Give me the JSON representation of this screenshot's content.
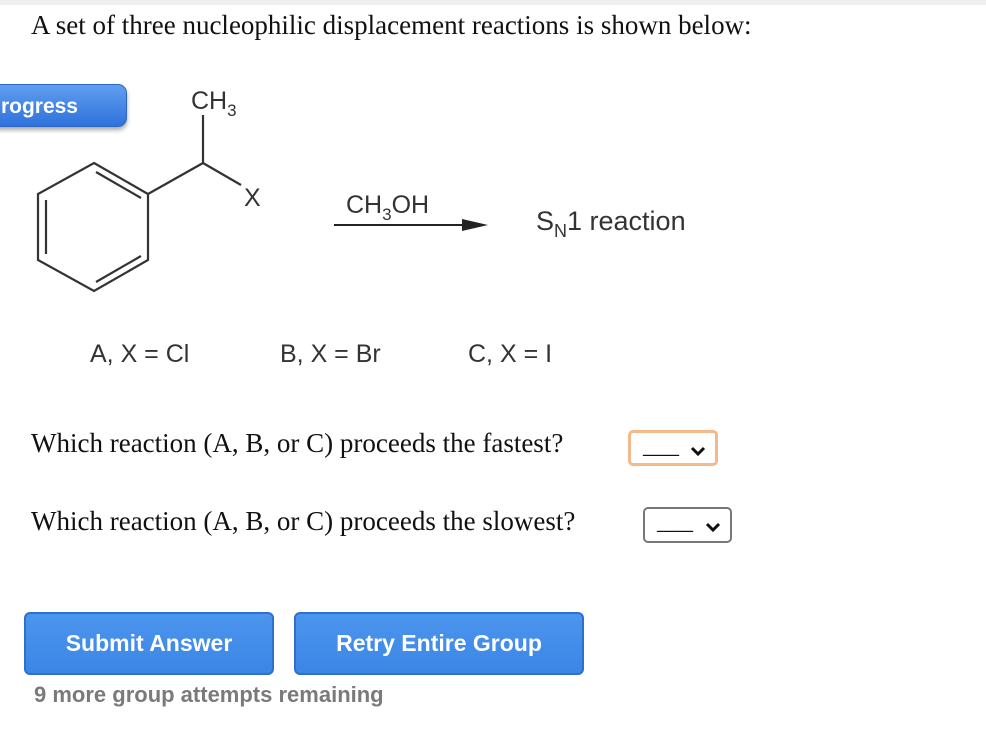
{
  "intro_text": "A set of three nucleophilic displacement reactions is shown below:",
  "progress_button_label": "rogress",
  "scheme": {
    "substituent_top": "CH",
    "substituent_top_sub": "3",
    "leaving_group": "X",
    "reagent_main": "CH",
    "reagent_sub": "3",
    "reagent_tail": "OH",
    "product_s": "S",
    "product_sub": "N",
    "product_tail": "1 reaction"
  },
  "variants": [
    {
      "label": "A,  X = Cl"
    },
    {
      "label": "B,  X = Br"
    },
    {
      "label": "C,  X = I"
    }
  ],
  "questions": [
    {
      "text": "Which reaction (A, B, or C) proceeds the fastest?",
      "selected": "___",
      "focused": true
    },
    {
      "text": "Which reaction (A, B, or C) proceeds the slowest?",
      "selected": "___",
      "focused": false
    }
  ],
  "buttons": {
    "submit": "Submit Answer",
    "retry": "Retry Entire Group"
  },
  "attempts_text": "9 more group attempts remaining",
  "colors": {
    "button_blue": "#4a90e8",
    "focus_orange": "#f3b98a",
    "muted_gray": "#7a7a7a"
  }
}
